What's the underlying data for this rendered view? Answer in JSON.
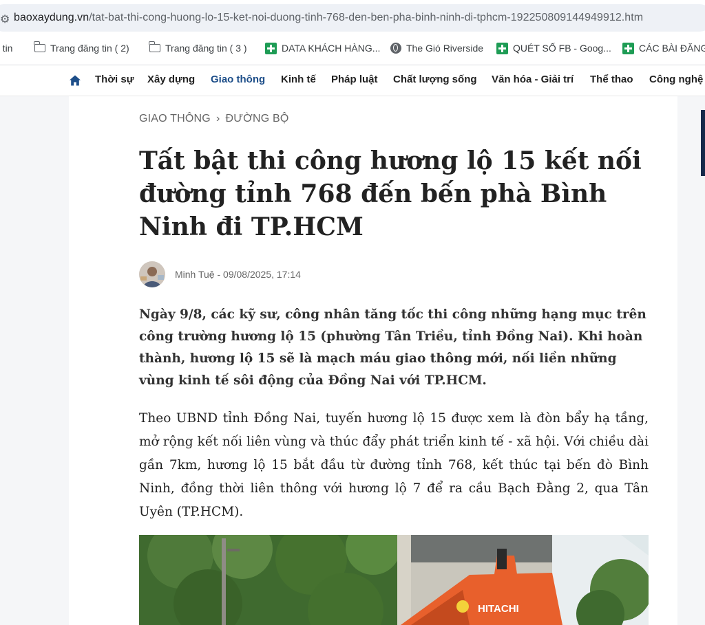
{
  "browser": {
    "url_domain": "baoxaydung.vn",
    "url_path": "/tat-bat-thi-cong-huong-lo-15-ket-noi-duong-tinh-768-den-ben-pha-binh-ninh-di-tphcm-192250809144949912.htm"
  },
  "bookmarks": [
    {
      "label": "g tin",
      "icon": "none"
    },
    {
      "label": "Trang đăng tin ( 2)",
      "icon": "folder-icon"
    },
    {
      "label": "Trang đăng tin ( 3 )",
      "icon": "folder-icon"
    },
    {
      "label": "DATA KHÁCH HÀNG...",
      "icon": "sheets-icon"
    },
    {
      "label": "The Gió Riverside",
      "icon": "globe-icon"
    },
    {
      "label": "QUÉT SỐ FB - Goog...",
      "icon": "sheets-icon"
    },
    {
      "label": "CÁC BÀI ĐĂNG",
      "icon": "sheets-icon"
    }
  ],
  "nav": {
    "items": [
      "Thời sự",
      "Xây dựng",
      "Giao thông",
      "Kinh tế",
      "Pháp luật",
      "Chất lượng sống",
      "Văn hóa - Giải trí",
      "Thể thao",
      "Công nghệ"
    ],
    "active": "Giao thông"
  },
  "article": {
    "breadcrumb": {
      "section": "GIAO THÔNG",
      "subsection": "ĐƯỜNG BỘ"
    },
    "title": "Tất bật thi công hương lộ 15 kết nối đường tỉnh 768 đến bến phà Bình Ninh đi TP.HCM",
    "author": "Minh Tuệ",
    "published": "09/08/2025, 17:14",
    "sapo": "Ngày 9/8, các kỹ sư, công nhân tăng tốc thi công những hạng mục trên công trường hương lộ 15 (phường Tân Triều, tỉnh Đồng Nai). Khi hoàn thành, hương lộ 15 sẽ là mạch máu giao thông mới, nối liền những vùng kinh tế sôi động của Đồng Nai với TP.HCM.",
    "paragraph_1": "Theo UBND tỉnh Đồng Nai, tuyến hương lộ 15 được xem là đòn bẩy hạ tầng, mở rộng kết nối liên vùng và thúc đẩy phát triển kinh tế - xã hội. Với chiều dài gần 7km, hương lộ 15 bắt đầu từ đường tỉnh 768, kết thúc tại bến đò Bình Ninh, đồng thời liên thông với hương lộ 7 để ra cầu Bạch Đằng 2, qua Tân Uyên (TP.HCM).",
    "photo_brand": "HITACHI"
  },
  "colors": {
    "nav_active": "#1d4e89",
    "excavator": "#e8602c",
    "foliage": "#4f7a3a"
  }
}
